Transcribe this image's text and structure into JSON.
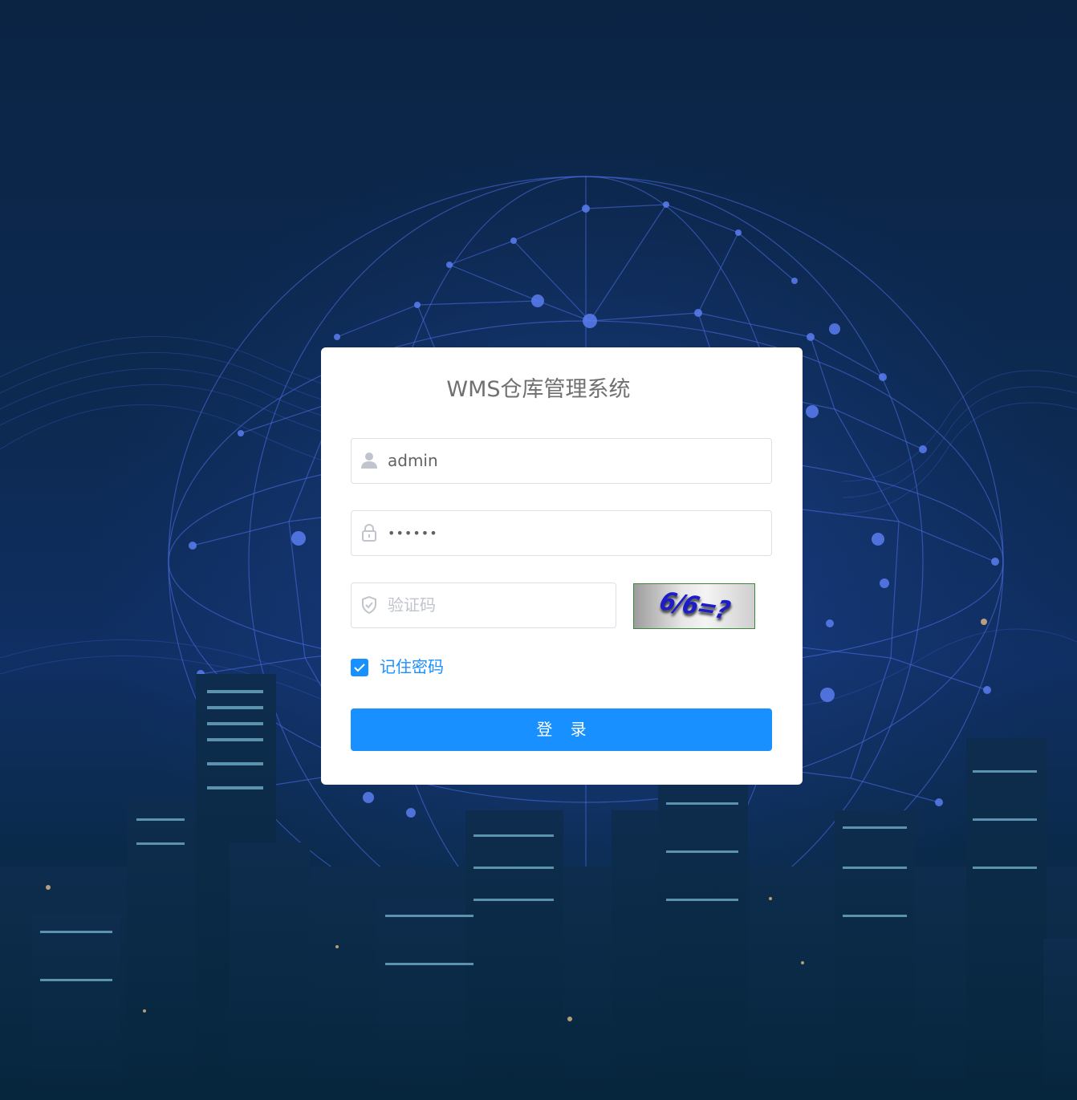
{
  "page": {
    "title": "WMS仓库管理系统"
  },
  "form": {
    "username": {
      "value": "admin",
      "icon": "user-icon"
    },
    "password": {
      "value": "••••••",
      "icon": "lock-icon"
    },
    "captcha": {
      "placeholder": "验证码",
      "icon": "shield-check-icon",
      "image_text": "6/6=?"
    },
    "remember": {
      "label": "记住密码",
      "checked": true
    },
    "login_button": "登 录"
  },
  "colors": {
    "primary": "#1890ff",
    "card_bg": "#ffffff",
    "title_text": "#707070",
    "border": "#dcdfe6",
    "placeholder": "#c0c4cc",
    "background_dark": "#0b2444"
  }
}
